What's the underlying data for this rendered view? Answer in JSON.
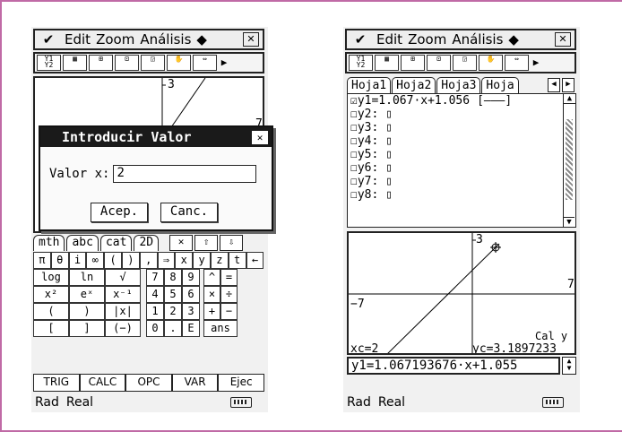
{
  "menu": {
    "items": [
      "Edit",
      "Zoom",
      "Análisis",
      "◆"
    ]
  },
  "status": {
    "angle": "Rad",
    "mode": "Real"
  },
  "left": {
    "graph": {
      "tick_top": "3",
      "tick_right": "7",
      "tick_right2": "7"
    },
    "dialog": {
      "title": "Introducir Valor",
      "label": "Valor x:",
      "value": "2",
      "ok": "Acep.",
      "cancel": "Canc."
    },
    "kb_tabs": [
      "mth",
      "abc",
      "cat",
      "2D"
    ],
    "kb_row0": [
      "π",
      "θ",
      "i",
      "∞",
      "(",
      ")",
      ",",
      "⇒",
      "x",
      "y",
      "z",
      "t",
      "←"
    ],
    "kb_rows": [
      [
        "log",
        "ln",
        "√",
        "7",
        "8",
        "9",
        "^",
        "="
      ],
      [
        "x²",
        "eˣ",
        "x⁻¹",
        "4",
        "5",
        "6",
        "×",
        "÷"
      ],
      [
        "(",
        ")",
        "|x|",
        "1",
        "2",
        "3",
        "+",
        "−"
      ],
      [
        "[",
        "]",
        "(−)",
        "0",
        ".",
        "E",
        "ans"
      ]
    ],
    "fn_keys": [
      "TRIG",
      "CALC",
      "OPC",
      "VAR",
      "Ejec"
    ]
  },
  "right": {
    "tabs": [
      "Hoja1",
      "Hoja2",
      "Hoja3",
      "Hoja"
    ],
    "equations": [
      "y1=1.067·x+1.056",
      "y2:",
      "y3:",
      "y4:",
      "y5:",
      "y6:",
      "y7:",
      "y8:"
    ],
    "eq_style": "[———]",
    "graph": {
      "tick_top": "3",
      "tick_right": "7",
      "tick_left": "−7",
      "label": "Cal y",
      "xc": "xc=2",
      "yc": "yc=3.1897233"
    },
    "entry": "y1=1.067193676·x+1.055"
  }
}
